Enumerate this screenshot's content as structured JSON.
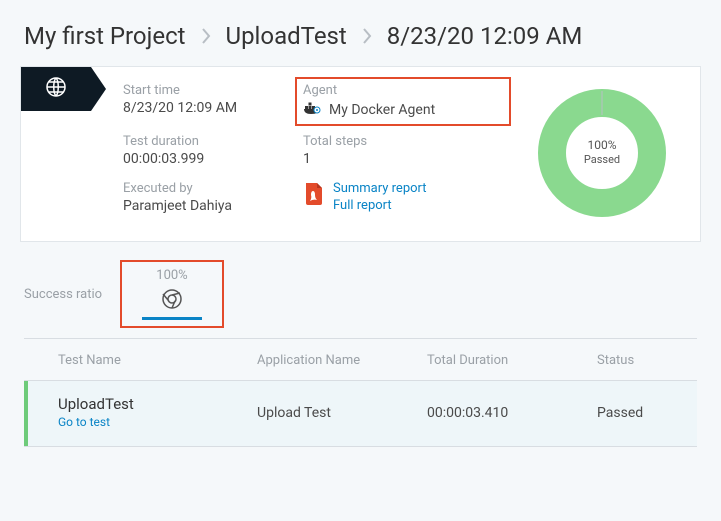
{
  "breadcrumb": {
    "project": "My first Project",
    "test": "UploadTest",
    "timestamp": "8/23/20 12:09 AM"
  },
  "info": {
    "start_time_label": "Start time",
    "start_time": "8/23/20 12:09 AM",
    "agent_label": "Agent",
    "agent": "My Docker Agent",
    "duration_label": "Test duration",
    "duration": "00:00:03.999",
    "total_steps_label": "Total steps",
    "total_steps": "1",
    "executed_by_label": "Executed by",
    "executed_by": "Paramjeet Dahiya",
    "summary_report": "Summary report",
    "full_report": "Full report"
  },
  "donut": {
    "passed_pct": "100%",
    "passed_label": "Passed"
  },
  "ratio": {
    "label": "Success ratio",
    "pct": "100%"
  },
  "table": {
    "headers": {
      "test_name": "Test Name",
      "app_name": "Application Name",
      "total_duration": "Total Duration",
      "status": "Status"
    },
    "row": {
      "test_name": "UploadTest",
      "go_to_test": "Go to test",
      "app_name": "Upload Test",
      "total_duration": "00:00:03.410",
      "status": "Passed"
    }
  },
  "chart_data": {
    "type": "pie",
    "title": "",
    "series": [
      {
        "name": "Passed",
        "value": 100,
        "color": "#8ad98f"
      }
    ],
    "center_label": "100% Passed"
  }
}
